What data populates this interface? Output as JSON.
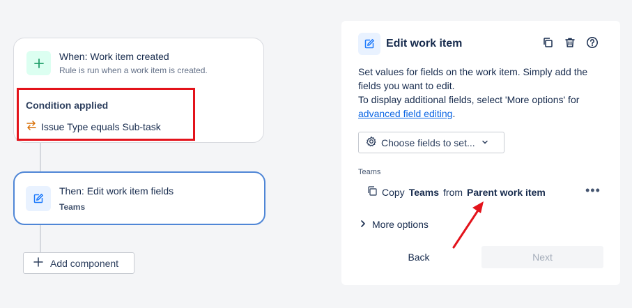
{
  "rule": {
    "trigger": {
      "title": "When: Work item created",
      "subtitle": "Rule is run when a work item is created."
    },
    "condition": {
      "heading": "Condition applied",
      "text": "Issue Type equals Sub-task"
    },
    "action": {
      "title": "Then: Edit work item fields",
      "subtitle": "Teams"
    },
    "add_component_label": "Add component"
  },
  "panel": {
    "title": "Edit work item",
    "description_line1": "Set values for fields on the work item. Simply add the fields you want to edit.",
    "description_line2_prefix": "To display additional fields, select 'More options' for",
    "description_link": "advanced field editing",
    "description_suffix": ".",
    "choose_fields_label": "Choose fields to set...",
    "field_label": "Teams",
    "field_row": {
      "prefix": "Copy",
      "field": "Teams",
      "middle": "from",
      "source": "Parent work item"
    },
    "more_options_label": "More options",
    "back_label": "Back",
    "next_label": "Next"
  },
  "colors": {
    "highlight_box": "#e3131b",
    "arrow": "#e3131b",
    "link": "#0c66e4",
    "selected_border": "#4f86d6",
    "trigger_icon_bg": "#dcfff1",
    "trigger_icon": "#22a06b"
  },
  "icons": {
    "trigger": "plus-icon",
    "condition": "swap-arrows-icon",
    "action": "pencil-edit-icon",
    "header_actions": [
      "duplicate-icon",
      "trash-icon",
      "help-icon"
    ],
    "choose_fields": "gear-icon",
    "copy": "copy-icon",
    "more": "more-horizontal-icon",
    "expand": "chevron-right-icon"
  }
}
